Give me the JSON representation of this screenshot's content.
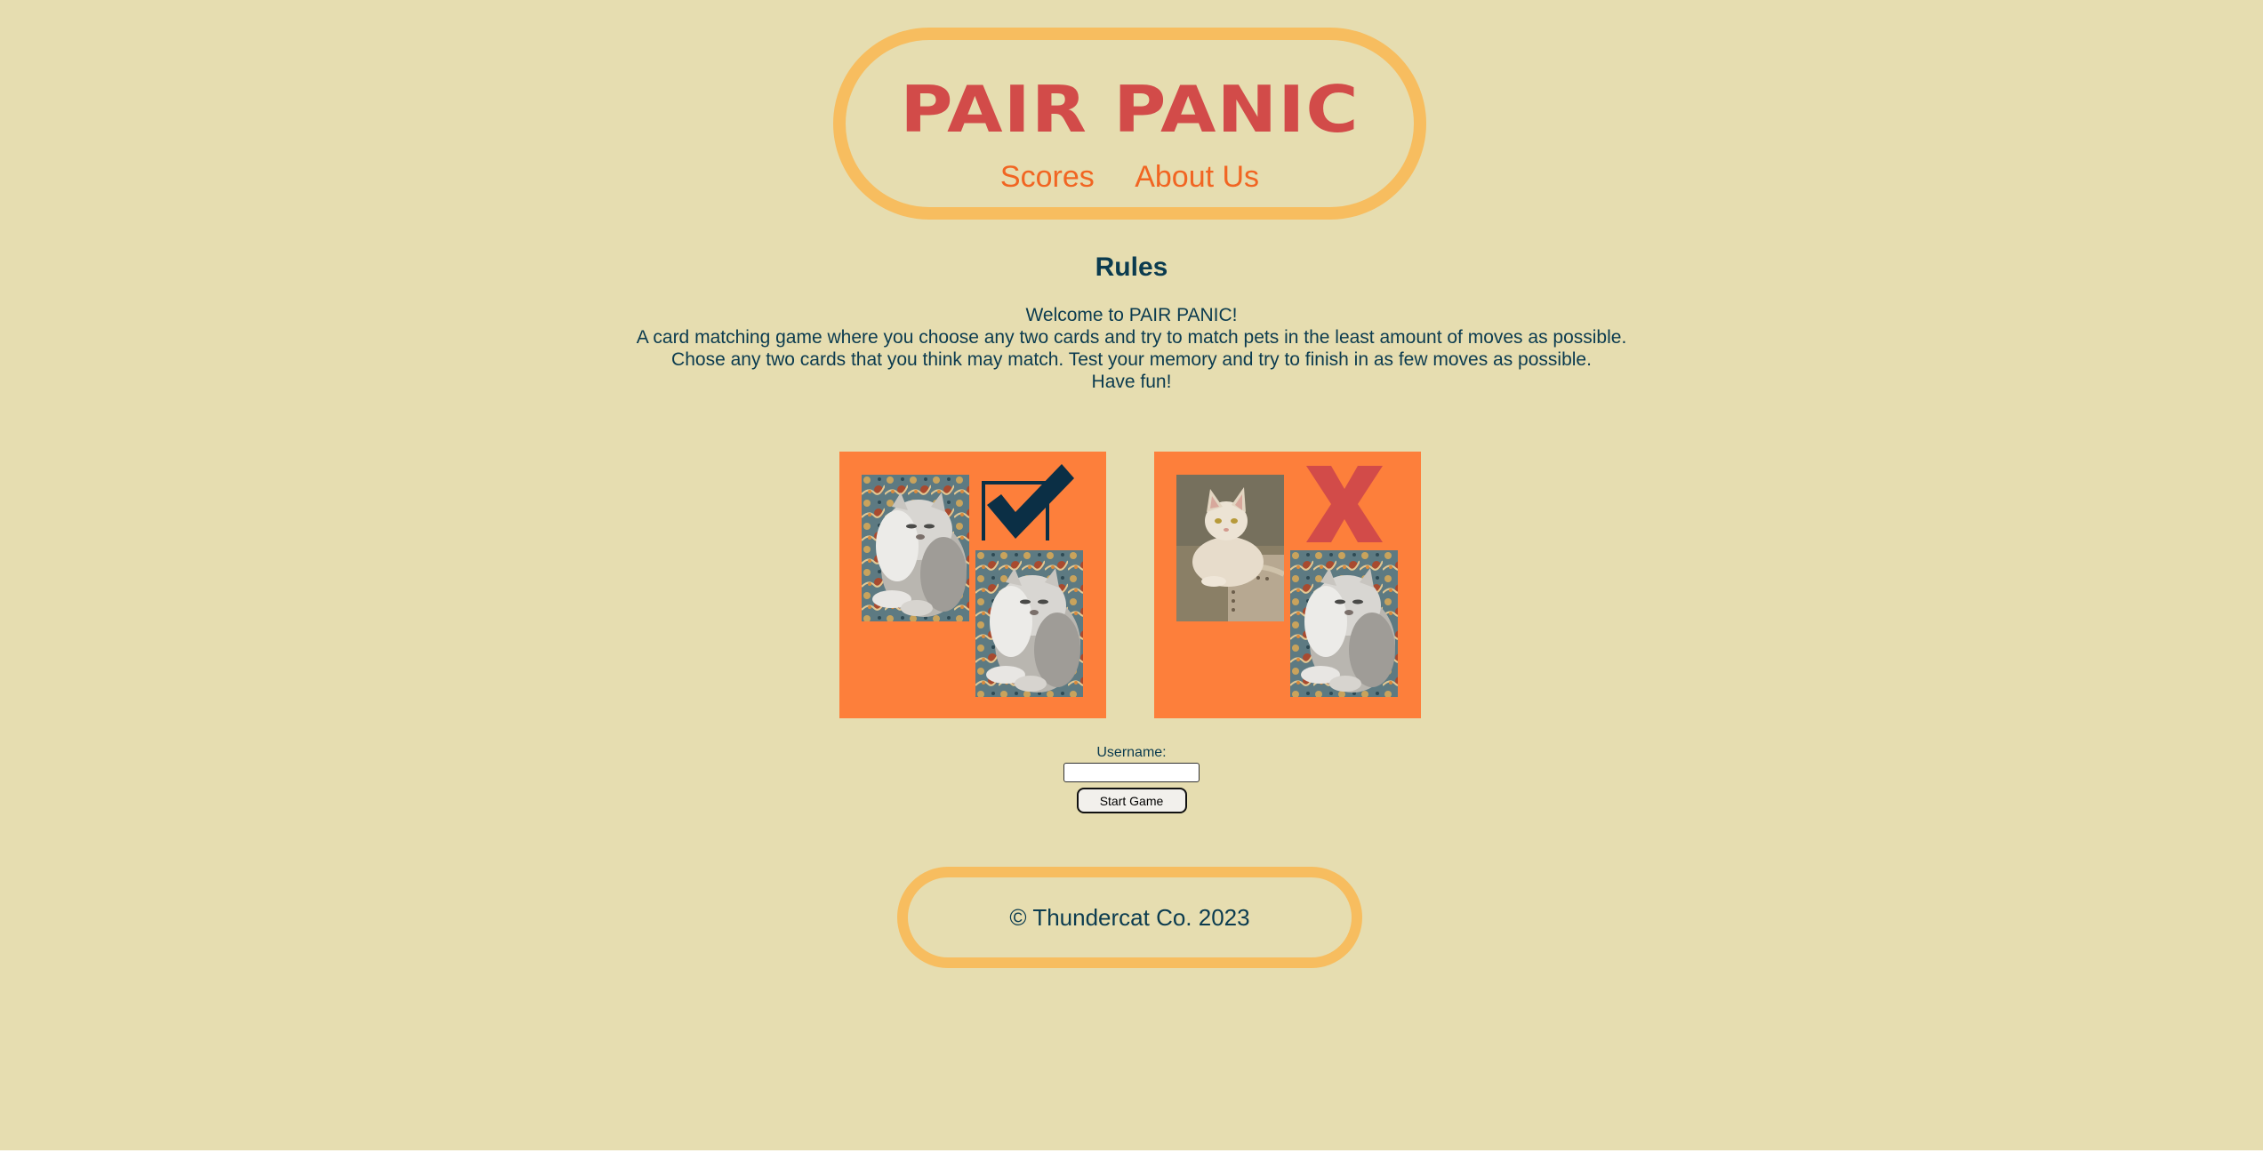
{
  "header": {
    "title": "PAIR PANIC",
    "nav": [
      {
        "label": "Scores"
      },
      {
        "label": "About Us"
      }
    ]
  },
  "rules": {
    "heading": "Rules",
    "lines": [
      "Welcome to PAIR PANIC!",
      "A card matching game where you choose any two cards and try to match pets in the least amount of moves as possible.",
      "Chose any two cards that you think may match. Test your memory and try to finish in as few moves as possible.",
      "Have fun!"
    ]
  },
  "examples": {
    "match": {
      "result": "correct",
      "icon": "checkmark-icon",
      "cards": [
        "fluffy-gray-cat-photo",
        "fluffy-gray-cat-photo"
      ]
    },
    "mismatch": {
      "result": "wrong",
      "icon": "x-icon",
      "cards": [
        "cream-cat-photo",
        "fluffy-gray-cat-photo"
      ]
    }
  },
  "form": {
    "username_label": "Username:",
    "username_value": "",
    "start_button": "Start Game"
  },
  "footer": {
    "copyright": "© Thundercat Co. 2023"
  },
  "colors": {
    "background": "#e6ddb0",
    "border_accent": "#f7bd5f",
    "title": "#d24b49",
    "nav": "#f16522",
    "text": "#0b3b4f",
    "panel": "#fd7f3b"
  }
}
